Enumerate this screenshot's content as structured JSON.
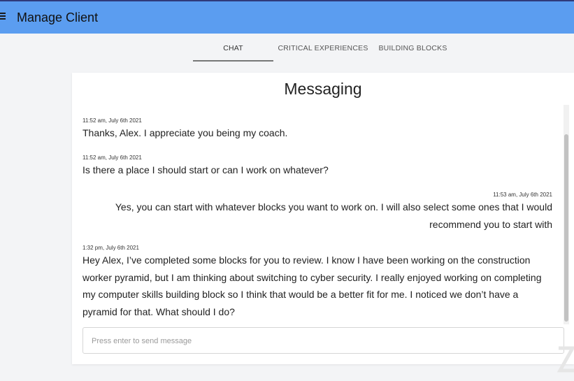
{
  "header": {
    "title": "Manage Client",
    "menu_icon": "hamburger-menu-icon"
  },
  "tabs": [
    {
      "label": "CHAT",
      "active": true
    },
    {
      "label": "CRITICAL EXPERIENCES",
      "active": false
    },
    {
      "label": "BUILDING BLOCKS",
      "active": false
    }
  ],
  "messaging": {
    "title": "Messaging",
    "messages": [
      {
        "timestamp": "11:52 am, July 6th 2021",
        "text": "Thanks, Alex. I appreciate you being my coach.",
        "align": "left"
      },
      {
        "timestamp": "11:52 am, July 6th 2021",
        "text": "Is there a place I should start or can I work on whatever?",
        "align": "left"
      },
      {
        "timestamp": "11:53 am, July 6th 2021",
        "text": "Yes, you can start with whatever blocks you want to work on. I will also select some ones that I would recommend you to start with",
        "align": "right"
      },
      {
        "timestamp": "1:32 pm, July 6th 2021",
        "text": "Hey Alex, I’ve completed some blocks for you to review. I know I have been working on the construction worker pyramid, but I am thinking about switching to cyber security. I really enjoyed working on completing my computer skills building block so I think that would be a better fit for me.  I noticed we don’t have a pyramid for that. What should I do?",
        "align": "left"
      }
    ],
    "input": {
      "value": "",
      "placeholder": "Press enter to send message"
    }
  },
  "colors": {
    "header_bg": "#5b9df0",
    "page_bg": "#f3f4f6",
    "panel_bg": "#ffffff"
  }
}
